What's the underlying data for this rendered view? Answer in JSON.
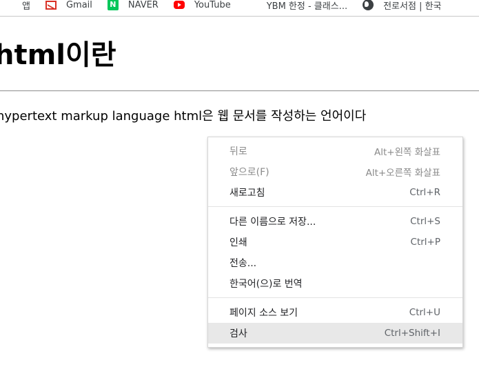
{
  "bookmarks": [
    {
      "icon": "apps-icon",
      "label": "앱"
    },
    {
      "icon": "gmail-icon",
      "label": "Gmail"
    },
    {
      "icon": "naver-icon",
      "label": "NAVER",
      "icon_text": "N"
    },
    {
      "icon": "youtube-icon",
      "label": "YouTube"
    },
    {
      "icon": "ybm-icon",
      "label": "YBM 한정 - 클래스..."
    },
    {
      "icon": "globe-icon",
      "label": "전로서점 | 한국"
    }
  ],
  "page": {
    "heading": "html이란",
    "paragraph": "hypertext markup language html은 웹 문서를 작성하는 언어이다"
  },
  "context_menu": {
    "items": [
      {
        "label": "뒤로",
        "shortcut": "Alt+왼쪽 화살표",
        "enabled": false
      },
      {
        "label": "앞으로(F)",
        "shortcut": "Alt+오른쪽 화살표",
        "enabled": false
      },
      {
        "label": "새로고침",
        "shortcut": "Ctrl+R",
        "enabled": true
      },
      {
        "label": "다른 이름으로 저장...",
        "shortcut": "Ctrl+S",
        "enabled": true
      },
      {
        "label": "인쇄",
        "shortcut": "Ctrl+P",
        "enabled": true
      },
      {
        "label": "전송...",
        "shortcut": "",
        "enabled": true
      },
      {
        "label": "한국어(으)로 번역",
        "shortcut": "",
        "enabled": true
      },
      {
        "label": "페이지 소스 보기",
        "shortcut": "Ctrl+U",
        "enabled": true
      },
      {
        "label": "검사",
        "shortcut": "Ctrl+Shift+I",
        "enabled": true,
        "highlighted": true
      }
    ]
  },
  "colors": {
    "naver": "#03c75a",
    "youtube": "#ff0000",
    "gmail": "#d93025",
    "highlight": "#e8e8e8"
  }
}
